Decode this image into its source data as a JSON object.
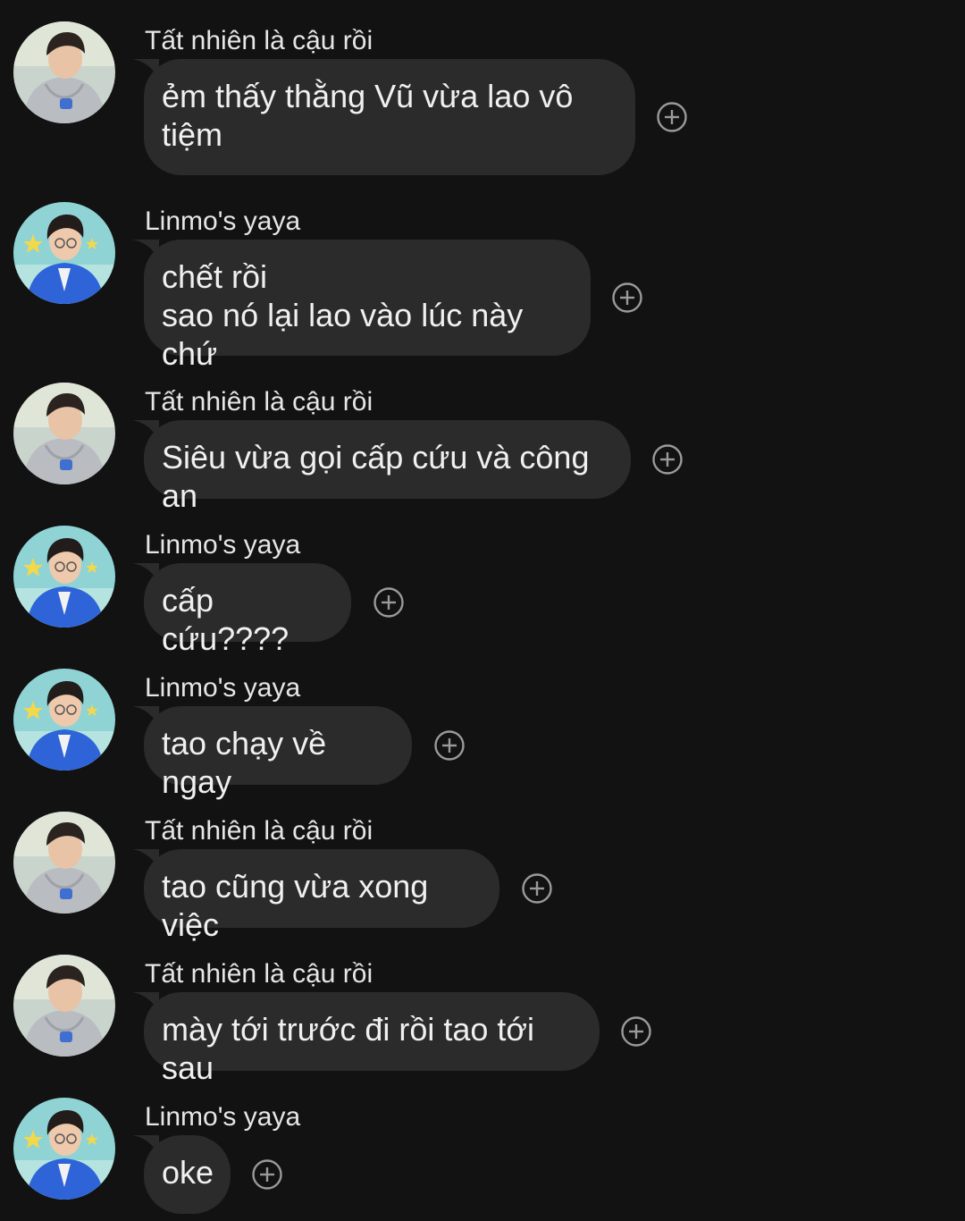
{
  "users": {
    "a": {
      "name": "Tất nhiên là cậu rồi",
      "avatar_icon": "avatar-gray-hoodie"
    },
    "b": {
      "name": "Linmo's yaya",
      "avatar_icon": "avatar-blue-jacket"
    }
  },
  "messages": [
    {
      "sender": "Tất nhiên là cậu rồi",
      "text": "ẻm thấy thằng Vũ vừa lao vô\ntiệm",
      "react_icon": "add-reaction-icon"
    },
    {
      "sender": "Linmo's yaya",
      "text": "chết rồi\nsao nó lại lao vào lúc này chứ",
      "react_icon": "add-reaction-icon"
    },
    {
      "sender": "Tất nhiên là cậu rồi",
      "text": "Siêu vừa gọi cấp cứu và công an",
      "react_icon": "add-reaction-icon"
    },
    {
      "sender": "Linmo's yaya",
      "text": "cấp cứu????",
      "react_icon": "add-reaction-icon"
    },
    {
      "sender": "Linmo's yaya",
      "text": "tao chạy về ngay",
      "react_icon": "add-reaction-icon"
    },
    {
      "sender": "Tất nhiên là cậu rồi",
      "text": "tao cũng vừa xong việc",
      "react_icon": "add-reaction-icon"
    },
    {
      "sender": "Tất nhiên là cậu rồi",
      "text": "mày tới trước đi rồi tao tới sau",
      "react_icon": "add-reaction-icon"
    },
    {
      "sender": "Linmo's yaya",
      "text": "oke",
      "react_icon": "add-reaction-icon"
    }
  ],
  "colors": {
    "background": "#121212",
    "bubble": "#2b2b2b",
    "text": "#f0f0f0",
    "sender": "#e6e6e6",
    "react_icon": "#9a9a9a"
  }
}
